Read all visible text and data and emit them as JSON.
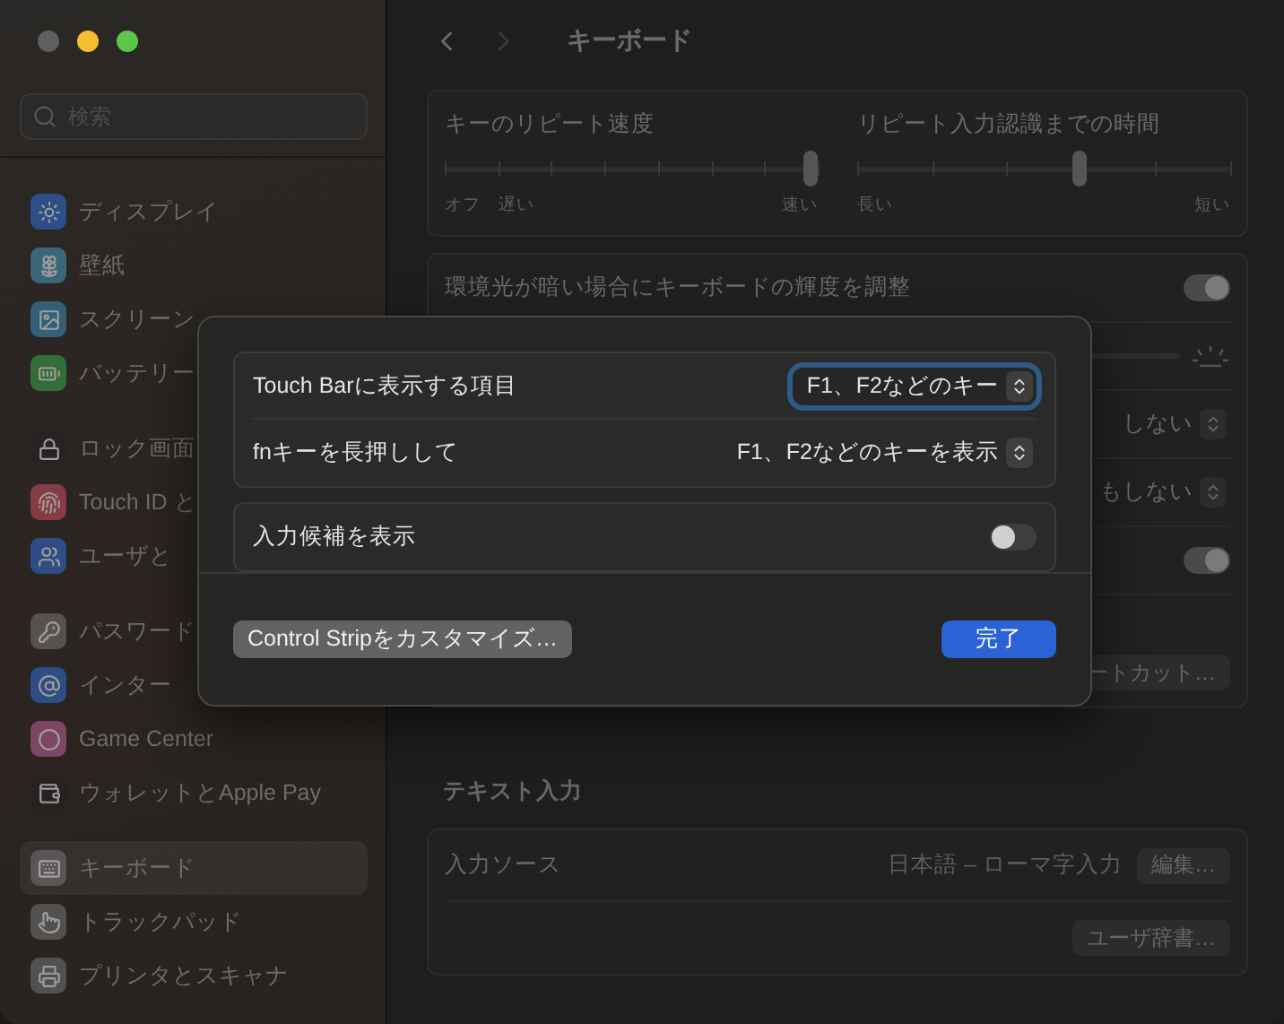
{
  "sidebar": {
    "search": {
      "placeholder": "検索"
    },
    "groups": [
      {
        "items": [
          {
            "label": "ディスプレイ",
            "selected": false
          },
          {
            "label": "壁紙",
            "selected": false
          },
          {
            "label": "スクリーン",
            "selected": false
          },
          {
            "label": "バッテリー",
            "selected": false
          }
        ]
      },
      {
        "items": [
          {
            "label": "ロック画面",
            "selected": false
          },
          {
            "label": "Touch ID と",
            "selected": false
          },
          {
            "label": "ユーザと",
            "selected": false
          }
        ]
      },
      {
        "items": [
          {
            "label": "パスワード",
            "selected": false
          },
          {
            "label": "インター",
            "selected": false
          },
          {
            "label": "Game Center",
            "selected": false
          },
          {
            "label": "ウォレットとApple Pay",
            "selected": false
          }
        ]
      },
      {
        "items": [
          {
            "label": "キーボード",
            "selected": true
          },
          {
            "label": "トラックパッド",
            "selected": false
          },
          {
            "label": "プリンタとスキャナ",
            "selected": false
          }
        ]
      }
    ]
  },
  "header": {
    "title": "キーボード"
  },
  "repeat_panel": {
    "sliders": [
      {
        "label": "キーのリピート速度",
        "level": 1,
        "tick_labels": [
          "オフ",
          "遅い",
          "速い"
        ]
      },
      {
        "label": "リピート入力認識までの時間",
        "level": 0.6,
        "tick_labels": [
          "長い",
          "短い"
        ]
      }
    ]
  },
  "backlight_panel": {
    "rows": [
      {
        "kind": "toggle",
        "label": "環境光が暗い場合にキーボードの輝度を調整",
        "on": true
      },
      {
        "kind": "slider"
      },
      {
        "kind": "popup",
        "value": "しない"
      },
      {
        "kind": "popup",
        "value": "もしない"
      },
      {
        "kind": "toggle",
        "on": true
      },
      {
        "kind": "button",
        "label": "ートカット…"
      }
    ]
  },
  "text_input": {
    "title": "テキスト入力",
    "rows": [
      {
        "kind": "source",
        "label": "入力ソース",
        "value": "日本語 – ローマ字入力",
        "button": "編集…"
      },
      {
        "kind": "button",
        "button": "ユーザ辞書…"
      }
    ]
  },
  "dialog": {
    "groups": [
      {
        "rows": [
          {
            "kind": "popup",
            "label": "Touch Barに表示する項目",
            "value": "F1、F2などのキー",
            "focused": true
          },
          {
            "kind": "popup",
            "label": "fnキーを長押しして",
            "value": "F1、F2などのキーを表示",
            "focused": false
          }
        ]
      },
      {
        "rows": [
          {
            "kind": "toggle",
            "label": "入力候補を表示",
            "on": false
          }
        ]
      }
    ],
    "secondary_button": "Control Stripをカスタマイズ…",
    "primary_button": "完了"
  }
}
